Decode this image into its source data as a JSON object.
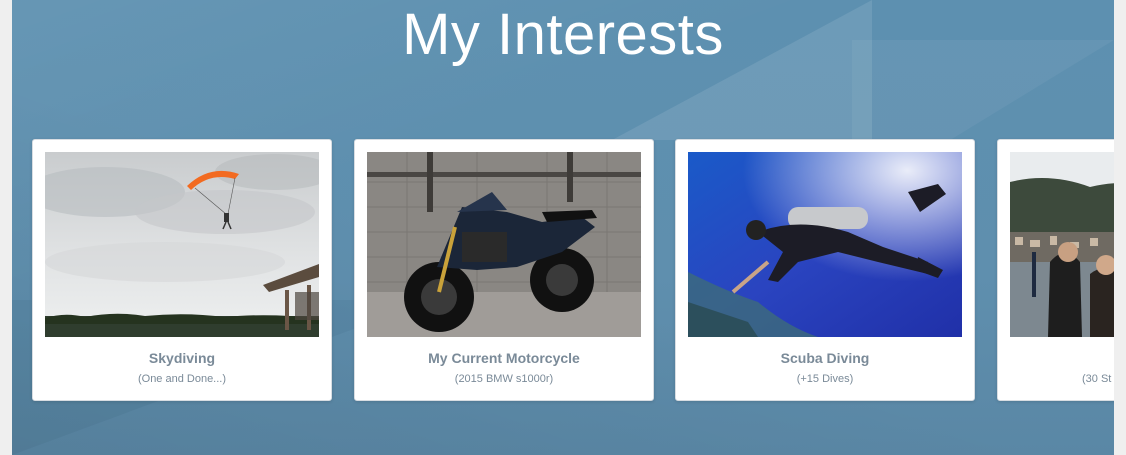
{
  "section": {
    "title": "My Interests"
  },
  "cards": [
    {
      "title": "Skydiving",
      "subtitle": "(One and Done...)"
    },
    {
      "title": "My Current Motorcycle",
      "subtitle": "(2015 BMW s1000r)"
    },
    {
      "title": "Scuba Diving",
      "subtitle": "(+15 Dives)"
    },
    {
      "title": "",
      "subtitle": "(30 St"
    }
  ],
  "colors": {
    "background": "#5f8fae",
    "title": "#ffffff",
    "card_text": "#7a8a98"
  }
}
